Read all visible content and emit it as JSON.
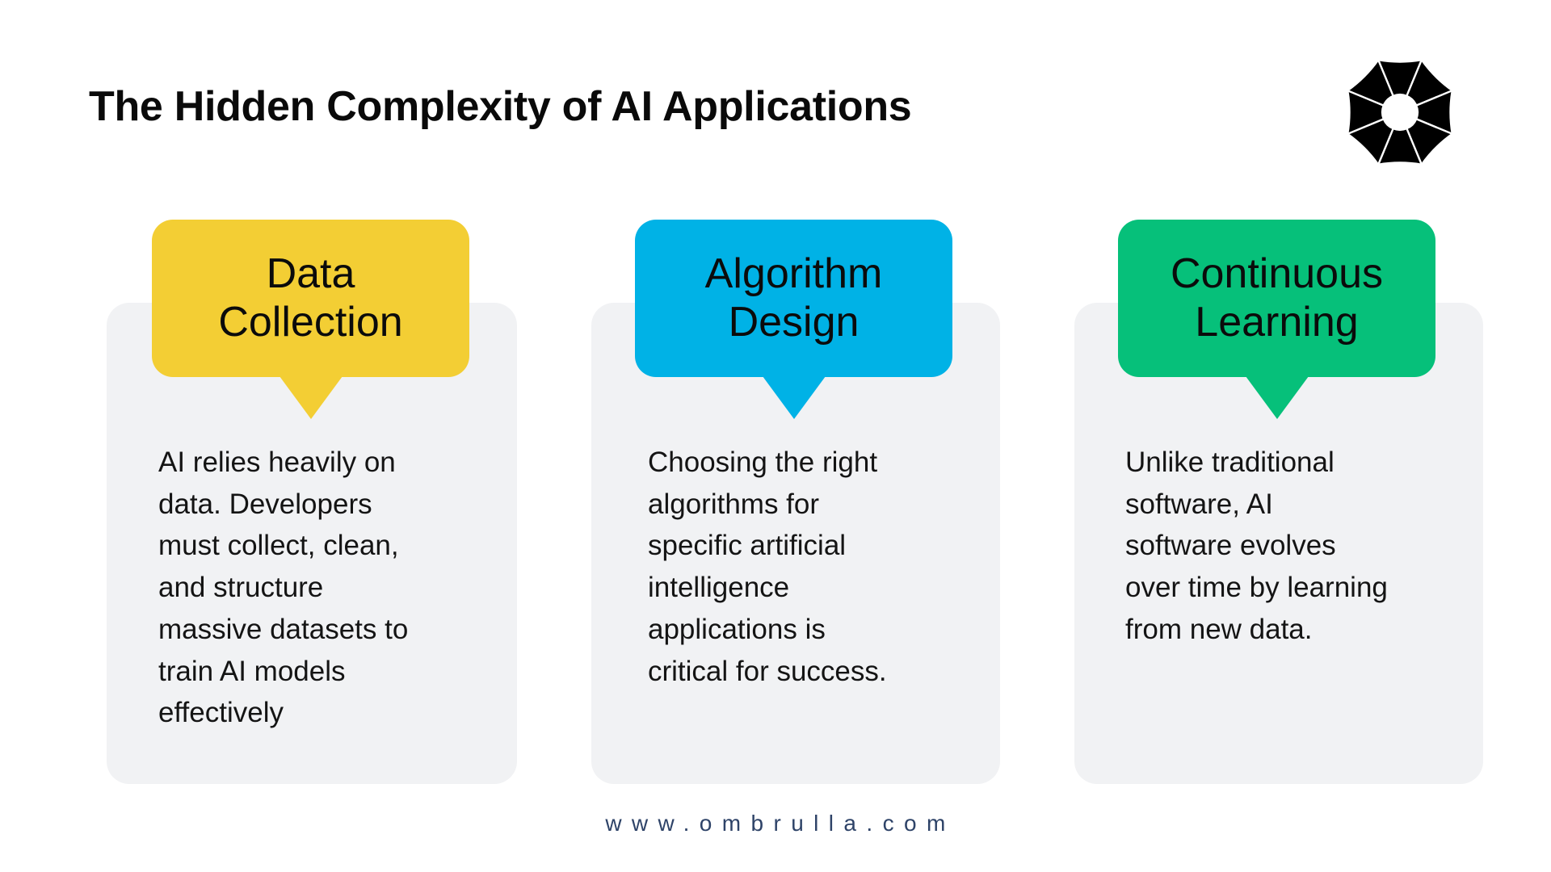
{
  "slide": {
    "title": "The Hidden Complexity of AI Applications",
    "logo_icon": "umbrella-octagon-logo-icon",
    "footer_url": "www.ombrulla.com",
    "colors": {
      "background": "#FFFFFF",
      "card_background": "#F1F2F4",
      "title_text": "#0A0A0A",
      "footer_text": "#2E4368"
    },
    "cards": [
      {
        "heading": "Data\nCollection",
        "heading_line1": "Data",
        "heading_line2": "Collection",
        "accent_color": "#F3CE34",
        "body": "AI relies heavily on data. Developers must collect, clean, and structure massive datasets to train AI models effectively",
        "body_lines": [
          "AI relies heavily on",
          "data. Developers",
          "must collect, clean,",
          "and structure",
          "massive datasets to",
          "train AI models",
          "effectively"
        ]
      },
      {
        "heading": "Algorithm\nDesign",
        "heading_line1": "Algorithm",
        "heading_line2": "Design",
        "accent_color": "#00B2E6",
        "body": "Choosing the right algorithms for specific artificial intelligence applications is critical for success.",
        "body_lines": [
          "Choosing the right",
          "algorithms for",
          "specific artificial",
          "intelligence",
          "applications is",
          "critical for success."
        ]
      },
      {
        "heading": "Continuous\nLearning",
        "heading_line1": "Continuous",
        "heading_line2": "Learning",
        "accent_color": "#06C07A",
        "body": "Unlike traditional software, AI software evolves over time by learning from new data.",
        "body_lines": [
          "Unlike traditional",
          "software, AI",
          "software evolves",
          "over time by learning",
          "from new data."
        ]
      }
    ]
  }
}
